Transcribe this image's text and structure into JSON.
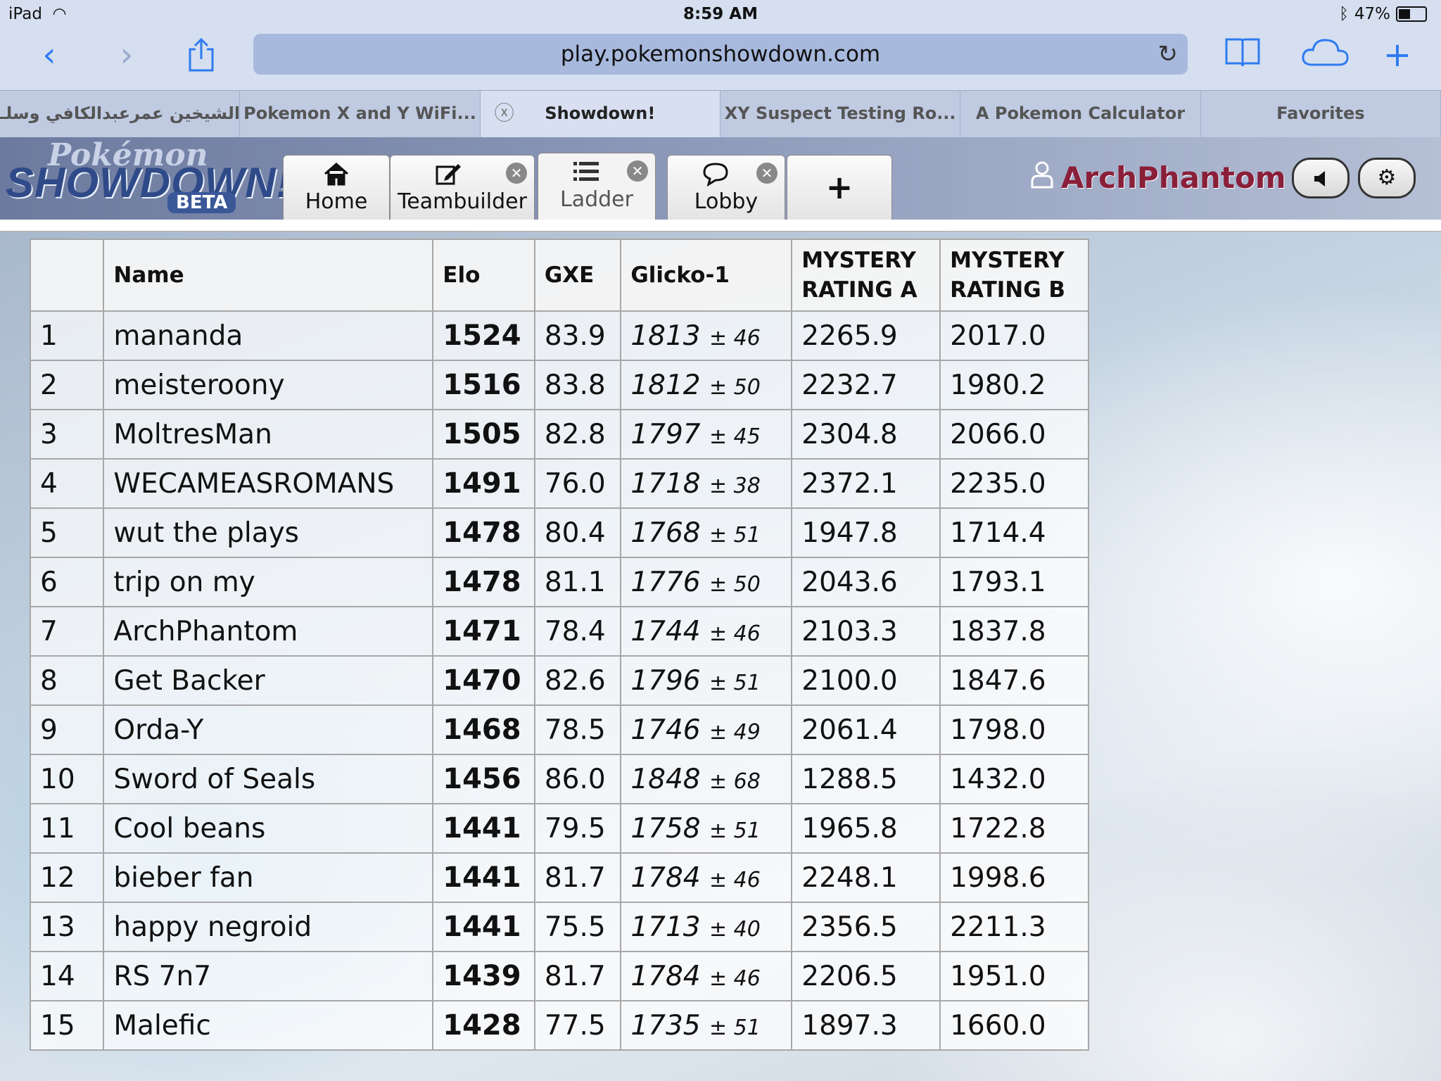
{
  "status": {
    "device": "iPad",
    "time": "8:59 AM",
    "battery": "47%"
  },
  "browser": {
    "url": "play.pokemonshowdown.com",
    "tabs": [
      {
        "label": "الشيخين عمرعبدالكافي وسلـ..."
      },
      {
        "label": "Pokemon X and Y WiFi..."
      },
      {
        "label": "Showdown!"
      },
      {
        "label": "XY Suspect Testing Ro..."
      },
      {
        "label": "A Pokemon Calculator"
      },
      {
        "label": "Favorites"
      }
    ]
  },
  "logo": {
    "line1": "Pokémon",
    "line2": "SHOWDOWN!",
    "line3": "BETA"
  },
  "nav_tabs": [
    {
      "label": "Home",
      "icon": "home-icon"
    },
    {
      "label": "Teambuilder",
      "icon": "edit-icon"
    },
    {
      "label": "Ladder",
      "icon": "list-icon"
    },
    {
      "label": "Lobby",
      "icon": "chat-bubble-icon"
    },
    {
      "label": "+",
      "icon": "plus-icon"
    }
  ],
  "user": {
    "name": "ArchPhantom"
  },
  "table": {
    "headers": [
      "",
      "Name",
      "Elo",
      "GXE",
      "Glicko-1",
      "MYSTERY RATING A",
      "MYSTERY RATING B"
    ],
    "header_ma_1": "MYSTERY",
    "header_ma_2": "RATING A",
    "header_mb_1": "MYSTERY",
    "header_mb_2": "RATING B",
    "rows": [
      {
        "rank": "1",
        "name": "mananda",
        "elo": "1524",
        "gxe": "83.9",
        "glicko": "1813",
        "dev": "± 46",
        "ma": "2265.9",
        "mb": "2017.0"
      },
      {
        "rank": "2",
        "name": "meisteroony",
        "elo": "1516",
        "gxe": "83.8",
        "glicko": "1812",
        "dev": "± 50",
        "ma": "2232.7",
        "mb": "1980.2"
      },
      {
        "rank": "3",
        "name": "MoltresMan",
        "elo": "1505",
        "gxe": "82.8",
        "glicko": "1797",
        "dev": "± 45",
        "ma": "2304.8",
        "mb": "2066.0"
      },
      {
        "rank": "4",
        "name": "WECAMEASROMANS",
        "elo": "1491",
        "gxe": "76.0",
        "glicko": "1718",
        "dev": "± 38",
        "ma": "2372.1",
        "mb": "2235.0"
      },
      {
        "rank": "5",
        "name": "wut the plays",
        "elo": "1478",
        "gxe": "80.4",
        "glicko": "1768",
        "dev": "± 51",
        "ma": "1947.8",
        "mb": "1714.4"
      },
      {
        "rank": "6",
        "name": "trip on my",
        "elo": "1478",
        "gxe": "81.1",
        "glicko": "1776",
        "dev": "± 50",
        "ma": "2043.6",
        "mb": "1793.1"
      },
      {
        "rank": "7",
        "name": "ArchPhantom",
        "elo": "1471",
        "gxe": "78.4",
        "glicko": "1744",
        "dev": "± 46",
        "ma": "2103.3",
        "mb": "1837.8"
      },
      {
        "rank": "8",
        "name": "Get Backer",
        "elo": "1470",
        "gxe": "82.6",
        "glicko": "1796",
        "dev": "± 51",
        "ma": "2100.0",
        "mb": "1847.6"
      },
      {
        "rank": "9",
        "name": "Orda-Y",
        "elo": "1468",
        "gxe": "78.5",
        "glicko": "1746",
        "dev": "± 49",
        "ma": "2061.4",
        "mb": "1798.0"
      },
      {
        "rank": "10",
        "name": "Sword of Seals",
        "elo": "1456",
        "gxe": "86.0",
        "glicko": "1848",
        "dev": "± 68",
        "ma": "1288.5",
        "mb": "1432.0"
      },
      {
        "rank": "11",
        "name": "Cool beans",
        "elo": "1441",
        "gxe": "79.5",
        "glicko": "1758",
        "dev": "± 51",
        "ma": "1965.8",
        "mb": "1722.8"
      },
      {
        "rank": "12",
        "name": "bieber fan",
        "elo": "1441",
        "gxe": "81.7",
        "glicko": "1784",
        "dev": "± 46",
        "ma": "2248.1",
        "mb": "1998.6"
      },
      {
        "rank": "13",
        "name": "happy negroid",
        "elo": "1441",
        "gxe": "75.5",
        "glicko": "1713",
        "dev": "± 40",
        "ma": "2356.5",
        "mb": "2211.3"
      },
      {
        "rank": "14",
        "name": "RS 7n7",
        "elo": "1439",
        "gxe": "81.7",
        "glicko": "1784",
        "dev": "± 46",
        "ma": "2206.5",
        "mb": "1951.0"
      },
      {
        "rank": "15",
        "name": "Malefic",
        "elo": "1428",
        "gxe": "77.5",
        "glicko": "1735",
        "dev": "± 51",
        "ma": "1897.3",
        "mb": "1660.0"
      }
    ]
  }
}
